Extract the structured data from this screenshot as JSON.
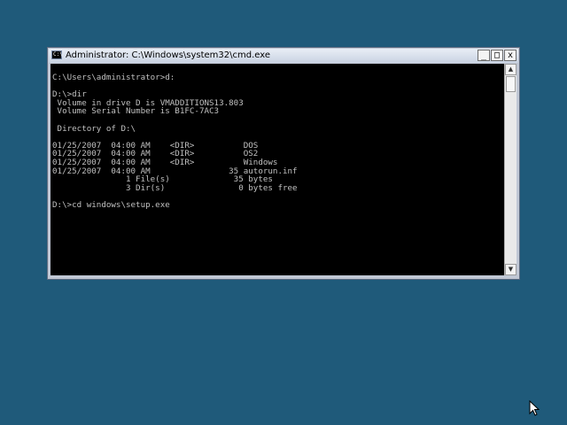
{
  "window": {
    "title": "Administrator: C:\\Windows\\system32\\cmd.exe",
    "icon_text": "C:\\",
    "minimize": "_",
    "maximize": "□",
    "close": "x"
  },
  "console": {
    "text": "C:\\Users\\administrator>d:\n\nD:\\>dir\n Volume in drive D is VMADDITIONS13.803\n Volume Serial Number is B1FC-7AC3\n\n Directory of D:\\\n\n01/25/2007  04:00 AM    <DIR>          DOS\n01/25/2007  04:00 AM    <DIR>          OS2\n01/25/2007  04:00 AM    <DIR>          Windows\n01/25/2007  04:00 AM                35 autorun.inf\n               1 File(s)             35 bytes\n               3 Dir(s)               0 bytes free\n\nD:\\>cd windows\\setup.exe"
  },
  "scrollbar": {
    "up": "▲",
    "down": "▼"
  }
}
